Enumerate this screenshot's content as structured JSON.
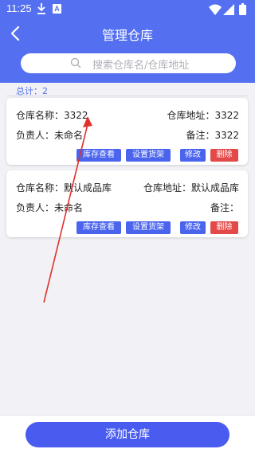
{
  "status": {
    "time": "11:25"
  },
  "header": {
    "title": "管理仓库"
  },
  "search": {
    "placeholder": "搜索仓库名/仓库地址"
  },
  "total": "总计：2",
  "warehouses": [
    {
      "name_text": "仓库名称：3322",
      "address_text": "仓库地址：3322",
      "manager_text": "负责人：未命名",
      "note_text": "备注：3322"
    },
    {
      "name_text": "仓库名称：默认成品库",
      "address_text": "仓库地址：默认成品库",
      "manager_text": "负责人：未命名",
      "note_text": "备注："
    }
  ],
  "actions": {
    "stock": "库存查看",
    "shelf": "设置货架",
    "edit": "修改",
    "delete": "删除"
  },
  "footer": {
    "add_label": "添加仓库"
  },
  "colors": {
    "primary": "#5470f0",
    "danger": "#e24a4a",
    "annotation": "#e0322c"
  }
}
